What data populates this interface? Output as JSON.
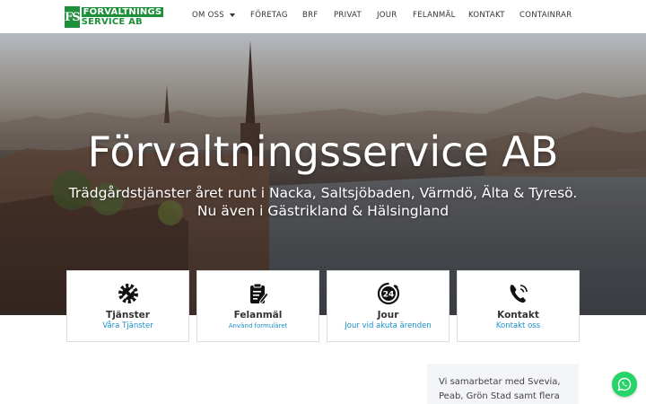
{
  "brand": {
    "logo_mark": "FS",
    "logo_line1": "FÖRVALTNINGS",
    "logo_line2": "SERVICE AB",
    "color": "#1e8f3a"
  },
  "nav": {
    "items": [
      {
        "label": "OM OSS",
        "has_dropdown": true
      },
      {
        "label": "FÖRETAG"
      },
      {
        "label": "BRF"
      },
      {
        "label": "PRIVAT"
      },
      {
        "label": "JOUR"
      },
      {
        "label": "FELANMÄL"
      },
      {
        "label": "KONTAKT"
      },
      {
        "label": "CONTAINRAR"
      }
    ]
  },
  "hero": {
    "title": "Förvaltningsservice AB",
    "subtitle_line1": "Trädgårdstjänster året runt i Nacka, Saltsjöbaden, Värmdö, Älta & Tyresö.",
    "subtitle_line2": "Nu även i Gästrikland & Hälsingland"
  },
  "cards": [
    {
      "title": "Tjänster",
      "link": "Våra Tjänster",
      "icon": "gear-wrench-icon"
    },
    {
      "title": "Felanmäl",
      "link": "Använd formuläret",
      "icon": "clipboard-edit-icon"
    },
    {
      "title": "Jour",
      "link": "Jour vid akuta ärenden",
      "icon": "clock-24-icon"
    },
    {
      "title": "Kontakt",
      "link": "Kontakt oss",
      "icon": "phone-icon"
    }
  ],
  "side_box": {
    "text": "Vi samarbetar med Svevia,\nPeab, Grön Stad samt flera"
  },
  "chat": {
    "icon": "whatsapp-icon",
    "color": "#25d366"
  },
  "link_color": "#1a8fc9"
}
